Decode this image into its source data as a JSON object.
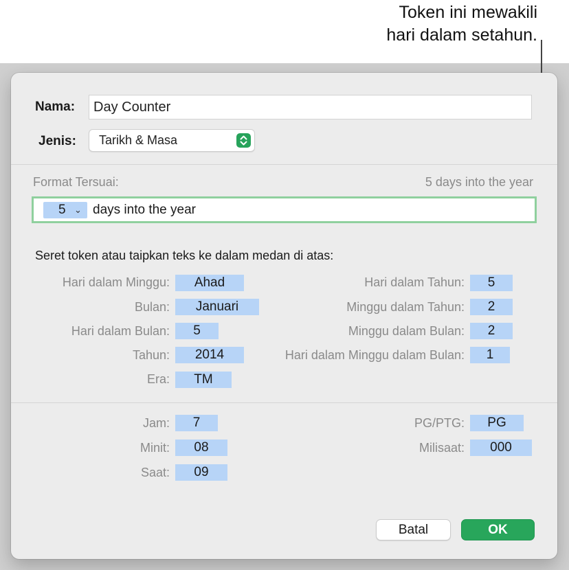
{
  "callout": {
    "line1": "Token ini mewakili",
    "line2": "hari dalam setahun."
  },
  "form": {
    "name_label": "Nama:",
    "name_value": "Day Counter",
    "type_label": "Jenis:",
    "type_value": "Tarikh & Masa"
  },
  "format": {
    "label": "Format Tersuai:",
    "preview": "5 days into the year",
    "token_value": "5",
    "token_chevron": "⌄",
    "text": "days into the year"
  },
  "instructions": "Seret token atau taipkan teks ke dalam medan di atas:",
  "date_tokens": {
    "left": [
      {
        "label": "Hari dalam Minggu:",
        "value": "Ahad"
      },
      {
        "label": "Bulan:",
        "value": "Januari"
      },
      {
        "label": "Hari dalam Bulan:",
        "value": "5"
      },
      {
        "label": "Tahun:",
        "value": "2014"
      },
      {
        "label": "Era:",
        "value": "TM"
      }
    ],
    "right": [
      {
        "label": "Hari dalam Tahun:",
        "value": "5"
      },
      {
        "label": "Minggu dalam Tahun:",
        "value": "2"
      },
      {
        "label": "Minggu dalam Bulan:",
        "value": "2"
      },
      {
        "label": "Hari dalam Minggu dalam Bulan:",
        "value": "1"
      }
    ]
  },
  "time_tokens": {
    "left": [
      {
        "label": "Jam:",
        "value": "7"
      },
      {
        "label": "Minit:",
        "value": "08"
      },
      {
        "label": "Saat:",
        "value": "09"
      }
    ],
    "right": [
      {
        "label": "PG/PTG:",
        "value": "PG"
      },
      {
        "label": "Milisaat:",
        "value": "000"
      }
    ]
  },
  "buttons": {
    "cancel": "Batal",
    "ok": "OK"
  },
  "colors": {
    "token_bg": "#b7d4f7",
    "accent_green": "#28a65b",
    "focus_ring": "#8fd09e"
  }
}
